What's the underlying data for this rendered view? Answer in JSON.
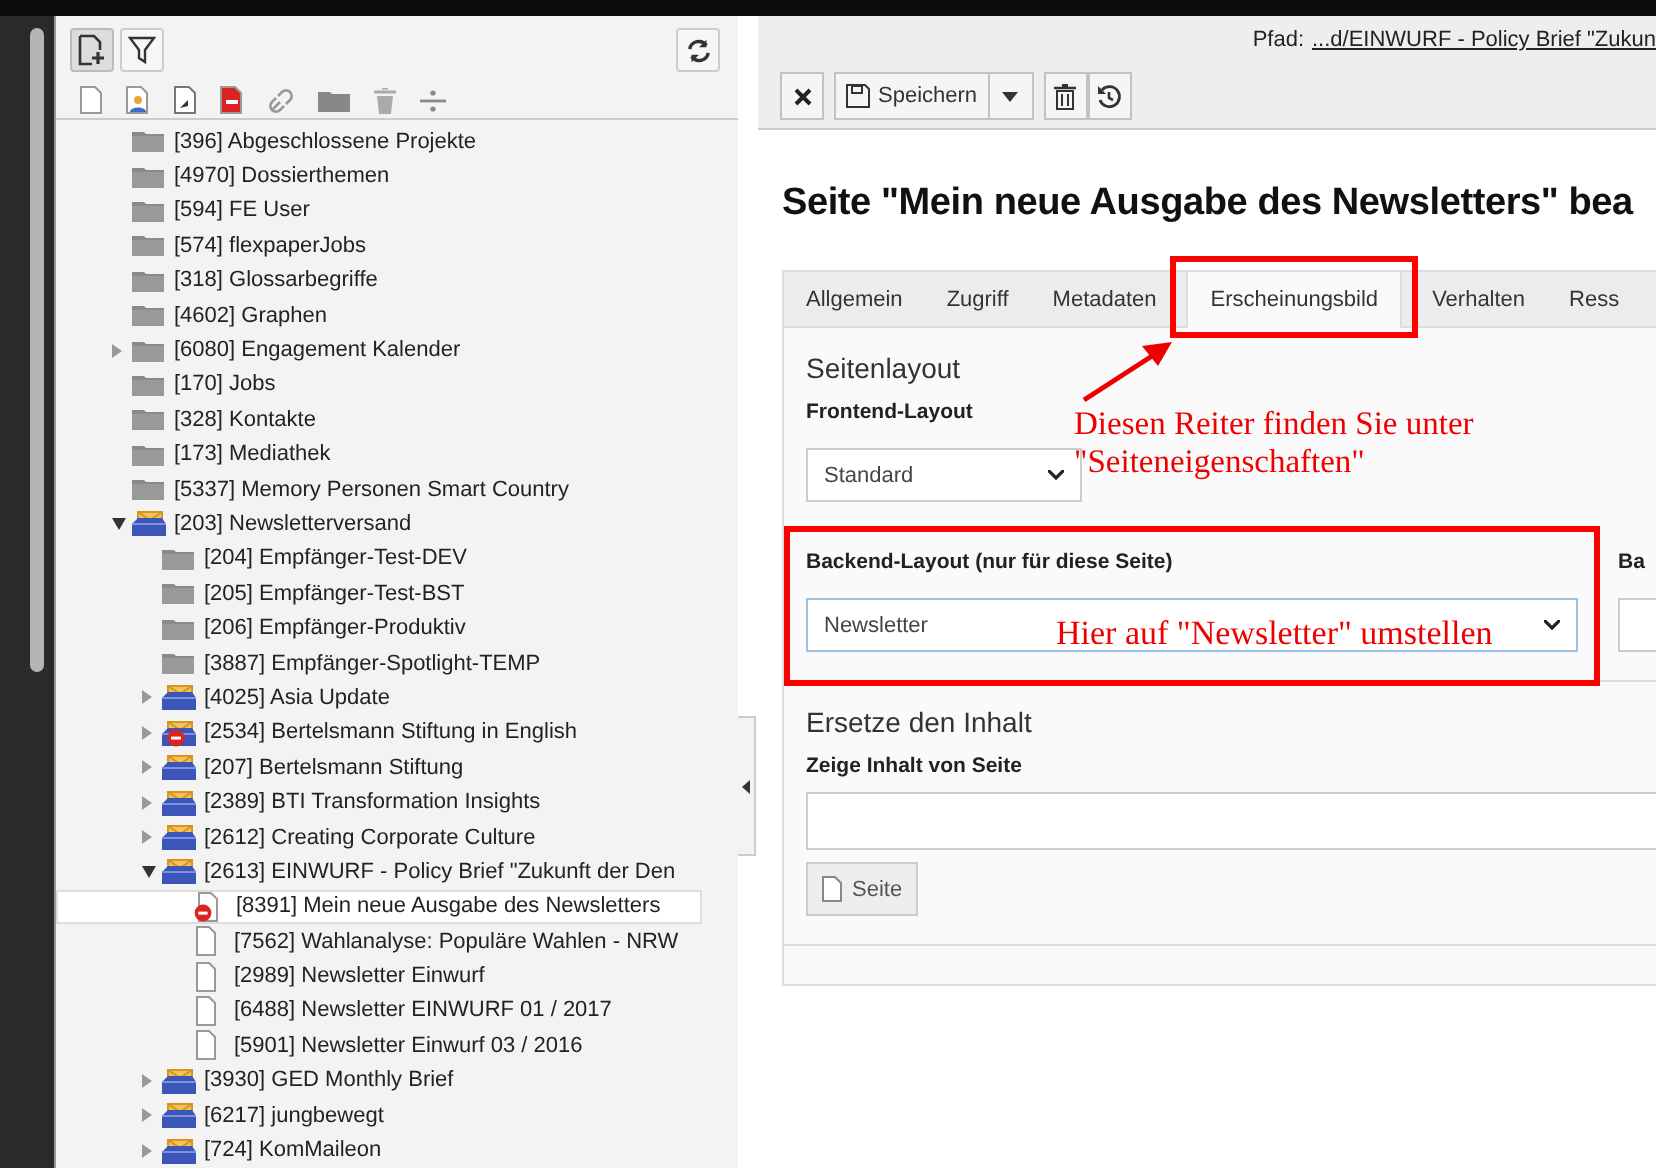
{
  "sidebar": {
    "tree_buttons": [
      {
        "kind": "new-page",
        "pressed": true
      },
      {
        "kind": "filter",
        "pressed": false
      }
    ],
    "actions": [
      {
        "kind": "page"
      },
      {
        "kind": "user-page"
      },
      {
        "kind": "shortcut"
      },
      {
        "kind": "page-red"
      },
      {
        "kind": "link"
      },
      {
        "kind": "folder"
      },
      {
        "kind": "trash"
      },
      {
        "kind": "divider"
      }
    ],
    "tree": [
      {
        "label": "[396] Abgeschlossene Projekte",
        "kind": "folder",
        "has_children": false,
        "selected": false
      },
      {
        "label": "[4970] Dossierthemen",
        "kind": "folder",
        "has_children": false,
        "selected": false
      },
      {
        "label": "[594] FE User",
        "kind": "folder",
        "has_children": false,
        "selected": false
      },
      {
        "label": "[574] flexpaperJobs",
        "kind": "folder",
        "has_children": false,
        "selected": false
      },
      {
        "label": "[318] Glossarbegriffe",
        "kind": "folder",
        "has_children": false,
        "selected": false
      },
      {
        "label": "[4602] Graphen",
        "kind": "folder",
        "has_children": false,
        "selected": false
      },
      {
        "label": "[6080] Engagement Kalender",
        "kind": "folder",
        "has_children": true,
        "expanded": false,
        "selected": false
      },
      {
        "label": "[170] Jobs",
        "kind": "folder",
        "has_children": false,
        "selected": false
      },
      {
        "label": "[328] Kontakte",
        "kind": "folder",
        "has_children": false,
        "selected": false
      },
      {
        "label": "[173] Mediathek",
        "kind": "folder",
        "has_children": false,
        "selected": false
      },
      {
        "label": "[5337] Memory Personen Smart Country",
        "kind": "folder",
        "has_children": false,
        "selected": false
      },
      {
        "label": "[203] Newsletterversand",
        "kind": "newsletter",
        "has_children": true,
        "expanded": true,
        "selected": false,
        "children": [
          {
            "label": "[204] Empfänger-Test-DEV",
            "kind": "folder",
            "has_children": false,
            "selected": false
          },
          {
            "label": "[205] Empfänger-Test-BST",
            "kind": "folder",
            "has_children": false,
            "selected": false
          },
          {
            "label": "[206] Empfänger-Produktiv",
            "kind": "folder",
            "has_children": false,
            "selected": false
          },
          {
            "label": "[3887] Empfänger-Spotlight-TEMP",
            "kind": "folder",
            "has_children": false,
            "selected": false
          },
          {
            "label": "[4025] Asia Update",
            "kind": "newsletter",
            "has_children": true,
            "expanded": false,
            "selected": false
          },
          {
            "label": "[2534] Bertelsmann Stiftung in English",
            "kind": "newsletter-hidden",
            "has_children": true,
            "expanded": false,
            "selected": false
          },
          {
            "label": "[207] Bertelsmann Stiftung",
            "kind": "newsletter",
            "has_children": true,
            "expanded": false,
            "selected": false
          },
          {
            "label": "[2389] BTI Transformation Insights",
            "kind": "newsletter",
            "has_children": true,
            "expanded": false,
            "selected": false
          },
          {
            "label": "[2612] Creating Corporate Culture",
            "kind": "newsletter",
            "has_children": true,
            "expanded": false,
            "selected": false
          },
          {
            "label": "[2613] EINWURF - Policy Brief \"Zukunft der Den",
            "kind": "newsletter",
            "has_children": true,
            "expanded": true,
            "selected": false,
            "children": [
              {
                "label": "[8391] Mein neue Ausgabe des Newsletters",
                "kind": "page-hidden",
                "has_children": false,
                "selected": true
              },
              {
                "label": "[7562] Wahlanalyse: Populäre Wahlen - NRW",
                "kind": "page",
                "has_children": false,
                "selected": false
              },
              {
                "label": "[2989] Newsletter Einwurf",
                "kind": "page",
                "has_children": false,
                "selected": false
              },
              {
                "label": "[6488] Newsletter EINWURF 01 / 2017",
                "kind": "page",
                "has_children": false,
                "selected": false
              },
              {
                "label": "[5901] Newsletter Einwurf 03 / 2016",
                "kind": "page",
                "has_children": false,
                "selected": false
              }
            ]
          },
          {
            "label": "[3930] GED Monthly Brief",
            "kind": "newsletter",
            "has_children": true,
            "expanded": false,
            "selected": false
          },
          {
            "label": "[6217] jungbewegt",
            "kind": "newsletter",
            "has_children": true,
            "expanded": false,
            "selected": false
          },
          {
            "label": "[724] KomMaileon",
            "kind": "newsletter",
            "has_children": true,
            "expanded": false,
            "selected": false
          }
        ]
      }
    ]
  },
  "path": {
    "label": "Pfad:",
    "link": "...d/EINWURF - Policy Brief \"Zukun"
  },
  "toolbar": {
    "save": "Speichern"
  },
  "heading": "Seite \"Mein neue Ausgabe des Newsletters\" bea",
  "tabs": [
    {
      "label": "Allgemein",
      "selected": false,
      "highlighted": false
    },
    {
      "label": "Zugriff",
      "selected": false,
      "highlighted": false
    },
    {
      "label": "Metadaten",
      "selected": false,
      "highlighted": false
    },
    {
      "label": "Erscheinungsbild",
      "selected": true,
      "highlighted": true
    },
    {
      "label": "Verhalten",
      "selected": false,
      "highlighted": false
    },
    {
      "label": "Ress",
      "selected": false,
      "highlighted": false
    }
  ],
  "sections": [
    {
      "title": "Seitenlayout",
      "fields": [
        {
          "label": "Frontend-Layout",
          "kind": "select",
          "value": "Standard",
          "highlighted": false
        },
        {
          "label": "Backend-Layout (nur für diese Seite)",
          "kind": "select",
          "value": "Newsletter",
          "highlighted": true
        },
        {
          "label": "Ba",
          "kind": "select",
          "highlighted": false
        }
      ]
    },
    {
      "title": "Ersetze den Inhalt",
      "fields": [
        {
          "label": "Zeige Inhalt von Seite",
          "kind": "page-picker",
          "button": "Seite",
          "highlighted": false
        }
      ]
    }
  ],
  "annotations": [
    {
      "kind": "note",
      "text": "Diesen Reiter finden Sie unter \"Seiteneigenschaften\""
    },
    {
      "kind": "arrow"
    },
    {
      "kind": "note",
      "text": "Hier auf \"Newsletter\" umstellen"
    }
  ]
}
